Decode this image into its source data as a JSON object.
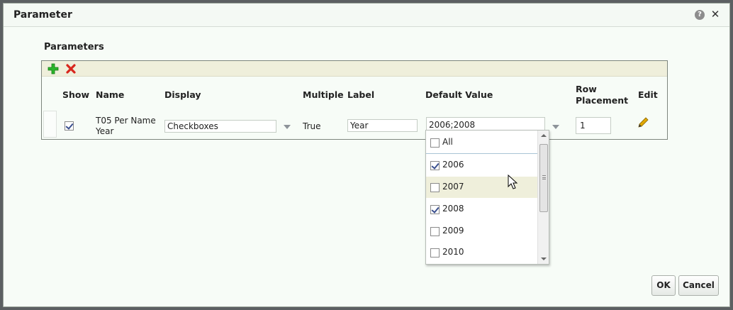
{
  "dialog": {
    "title": "Parameter"
  },
  "section": {
    "title": "Parameters"
  },
  "table": {
    "headers": {
      "show": "Show",
      "name": "Name",
      "display": "Display",
      "multiple": "Multiple",
      "label": "Label",
      "default_value": "Default Value",
      "row_placement_line1": "Row",
      "row_placement_line2": "Placement",
      "edit": "Edit"
    },
    "row": {
      "show_checked": true,
      "name_line1": "T05 Per Name",
      "name_line2": "Year",
      "display": "Checkboxes",
      "multiple": "True",
      "label": "Year",
      "default_value": "2006;2008",
      "row_placement": "1"
    }
  },
  "dropdown": {
    "all_label": "All",
    "items": [
      {
        "label": "2006",
        "checked": true
      },
      {
        "label": "2007",
        "checked": false
      },
      {
        "label": "2008",
        "checked": true
      },
      {
        "label": "2009",
        "checked": false
      },
      {
        "label": "2010",
        "checked": false
      }
    ]
  },
  "buttons": {
    "ok": "OK",
    "cancel": "Cancel"
  },
  "colors": {
    "add": "#2bb52b",
    "delete": "#d8261d",
    "toolbar_bg": "#efefdb",
    "hover_bg": "#efefdb",
    "pencil": "#e0a800"
  },
  "icons": [
    "help-icon",
    "close-icon",
    "add-icon",
    "delete-icon",
    "chevron-down-icon",
    "pencil-icon",
    "mouse-cursor-icon"
  ]
}
